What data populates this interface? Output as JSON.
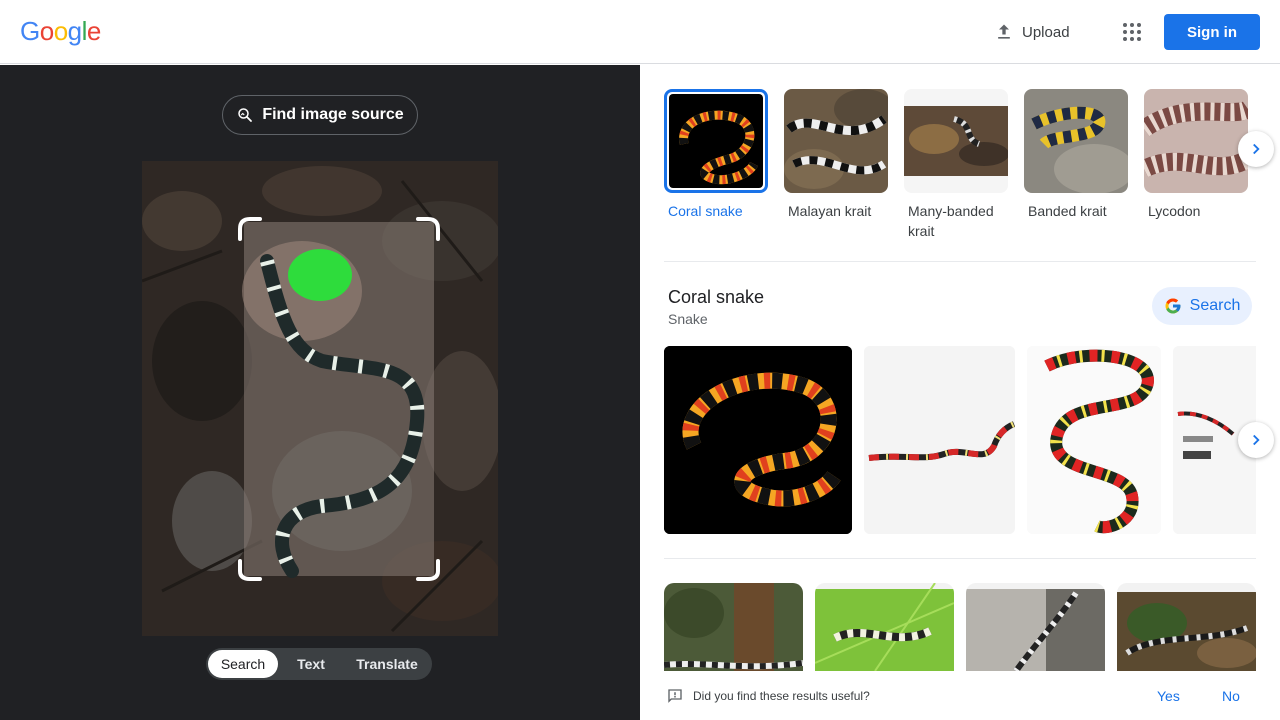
{
  "header": {
    "logo_letters": [
      {
        "char": "G",
        "color": "#4285F4"
      },
      {
        "char": "o",
        "color": "#EA4335"
      },
      {
        "char": "o",
        "color": "#FBBC05"
      },
      {
        "char": "g",
        "color": "#4285F4"
      },
      {
        "char": "l",
        "color": "#34A853"
      },
      {
        "char": "e",
        "color": "#EA4335"
      }
    ],
    "upload_label": "Upload",
    "upload_icon": "upload-icon",
    "apps_icon": "apps-grid-icon",
    "signin_label": "Sign in"
  },
  "left": {
    "find_source_label": "Find image source",
    "find_source_icon": "image-search-icon",
    "mode_tabs": [
      {
        "label": "Search",
        "active": true
      },
      {
        "label": "Text",
        "active": false
      },
      {
        "label": "Translate",
        "active": false
      }
    ]
  },
  "entities": [
    {
      "label": "Coral snake",
      "selected": true
    },
    {
      "label": "Malayan krait",
      "selected": false
    },
    {
      "label": "Many-banded krait",
      "selected": false
    },
    {
      "label": "Banded krait",
      "selected": false
    },
    {
      "label": "Lycodon",
      "selected": false
    }
  ],
  "knowledge": {
    "title": "Coral snake",
    "subtitle": "Snake",
    "search_label": "Search",
    "search_icon": "google-g-icon"
  },
  "feedback": {
    "question": "Did you find these results useful?",
    "icon": "feedback-icon",
    "yes_label": "Yes",
    "no_label": "No"
  },
  "colors": {
    "accent": "#1a73e8",
    "dark_pane": "#202124"
  }
}
